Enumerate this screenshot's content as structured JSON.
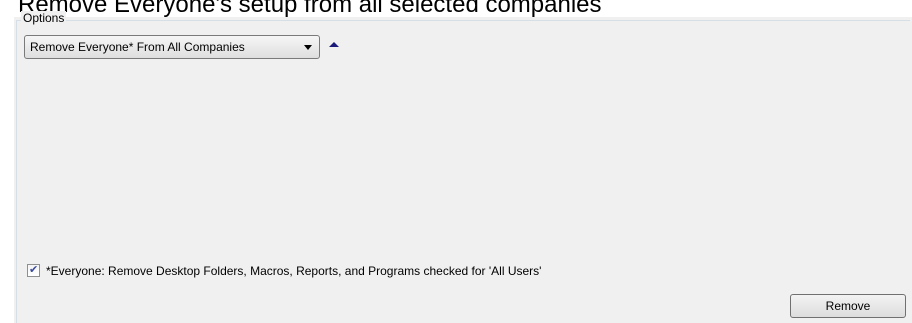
{
  "header": {
    "title": "Remove Everyone's setup from all selected companies"
  },
  "options": {
    "legend": "Options",
    "dropdown": {
      "selected": "Remove Everyone* From All Companies"
    },
    "collapse_icon": "triangle-up-icon"
  },
  "footnote": {
    "checked": true,
    "label": "*Everyone: Remove Desktop Folders, Macros, Reports, and Programs checked for 'All Users'"
  },
  "actions": {
    "remove_label": "Remove"
  },
  "colors": {
    "panel_bg": "#f0f0f0",
    "group_border": "#d5dfe5",
    "collapse_arrow": "#1a1a7a",
    "checkmark": "#3a4b9b"
  }
}
